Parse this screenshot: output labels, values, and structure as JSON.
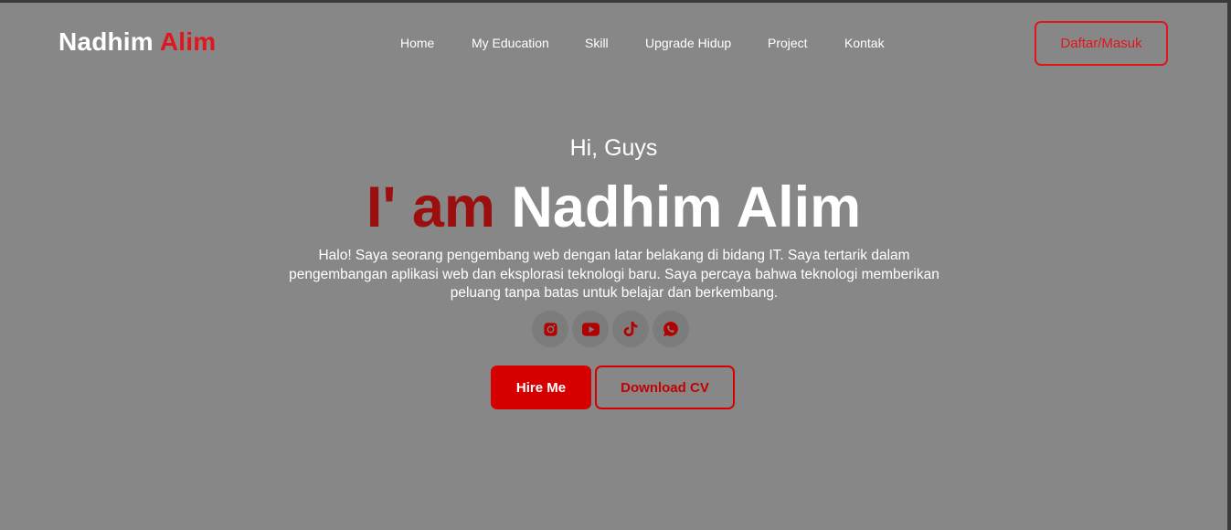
{
  "brand": {
    "first": "Nadhim",
    "last": "Alim"
  },
  "nav": {
    "links": [
      "Home",
      "My Education",
      "Skill",
      "Upgrade Hidup",
      "Project",
      "Kontak"
    ],
    "auth_label": "Daftar/Masuk"
  },
  "hero": {
    "greeting": "Hi, Guys",
    "headline_prefix": "I' am",
    "headline_name": "Nadhim Alim",
    "intro_lines": [
      "Halo! Saya seorang pengembang web dengan latar belakang di bidang IT. Saya tertarik dalam",
      "pengembangan aplikasi web dan eksplorasi teknologi baru. Saya percaya bahwa teknologi memberikan",
      "peluang tanpa batas untuk belajar dan berkembang."
    ],
    "socials": [
      "instagram-icon",
      "youtube-icon",
      "tiktok-icon",
      "whatsapp-icon"
    ],
    "hire_label": "Hire Me",
    "cv_label": "Download CV"
  },
  "colors": {
    "overlay_background": "#878787",
    "accent_red": "#e0161c",
    "headline_red": "#9c0f0f",
    "button_red": "#d60000",
    "text": "#ffffff"
  }
}
